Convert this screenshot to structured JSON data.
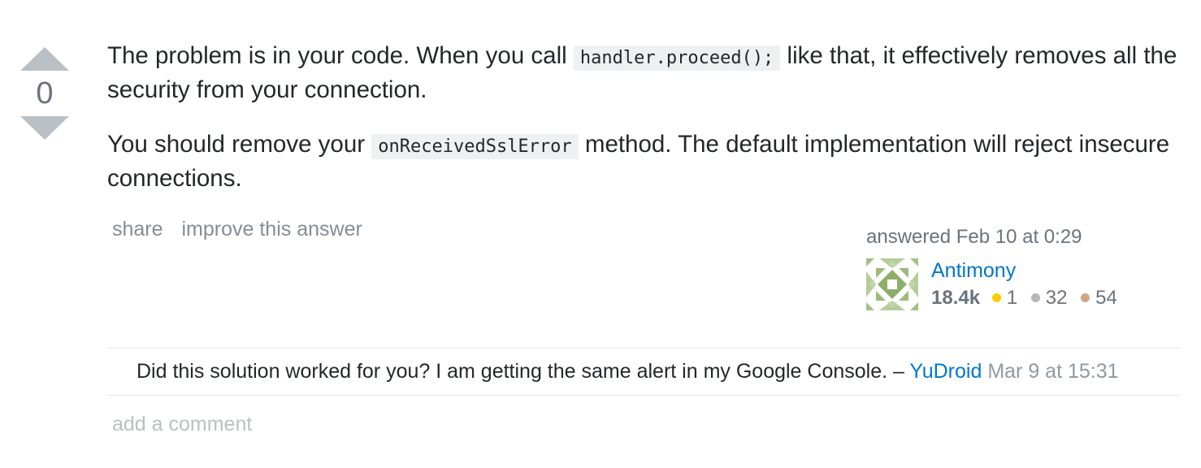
{
  "vote": {
    "count": "0"
  },
  "post": {
    "p1_before": "The problem is in your code. When you call ",
    "p1_code": "handler.proceed();",
    "p1_after": " like that, it effectively removes all the security from your connection.",
    "p2_before": "You should remove your ",
    "p2_code": "onReceivedSslError",
    "p2_after": " method. The default implementation will reject insecure connections."
  },
  "menu": {
    "share": "share",
    "improve": "improve this answer"
  },
  "user_info": {
    "action_time": "answered Feb 10 at 0:29",
    "name": "Antimony",
    "reputation": "18.4k",
    "gold": "1",
    "silver": "32",
    "bronze": "54",
    "gold_color": "#ffcc01",
    "silver_color": "#b4b8bc",
    "bronze_color": "#d1a684"
  },
  "comments": [
    {
      "text": "Did this solution worked for you? I am getting the same alert in my Google Console.",
      "separator": " – ",
      "user": "YuDroid",
      "date": "Mar 9 at 15:31"
    }
  ],
  "add_comment": "add a comment"
}
